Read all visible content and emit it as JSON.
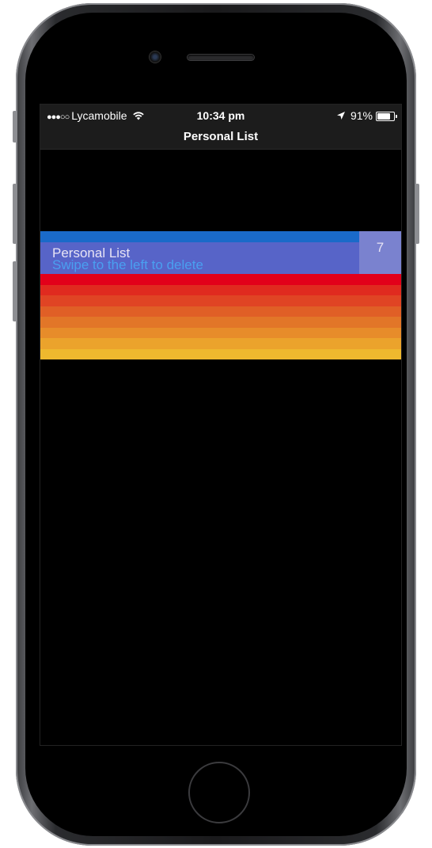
{
  "status_bar": {
    "signal": "●●●○○",
    "carrier": "Lycamobile",
    "wifi_icon": "wifi-icon",
    "time": "10:34 pm",
    "location_icon": "location-arrow-icon",
    "battery_percent": "91%",
    "battery_level": 0.91
  },
  "nav": {
    "title": "Personal List"
  },
  "list": {
    "items": [
      {
        "title": "Personal List",
        "subtitle": "Swipe to the left to delete",
        "count": "7"
      }
    ],
    "stripe_colors": [
      "#e2001a",
      "#e02a1f",
      "#e04424",
      "#e05f26",
      "#e27628",
      "#e78c2a",
      "#eba32c",
      "#eeb82e"
    ]
  },
  "colors": {
    "row_top_band": "#1a6ac9",
    "row_background": "#5764c8",
    "count_background": "#7a82cf",
    "subtitle_text": "#4a9ff0"
  }
}
